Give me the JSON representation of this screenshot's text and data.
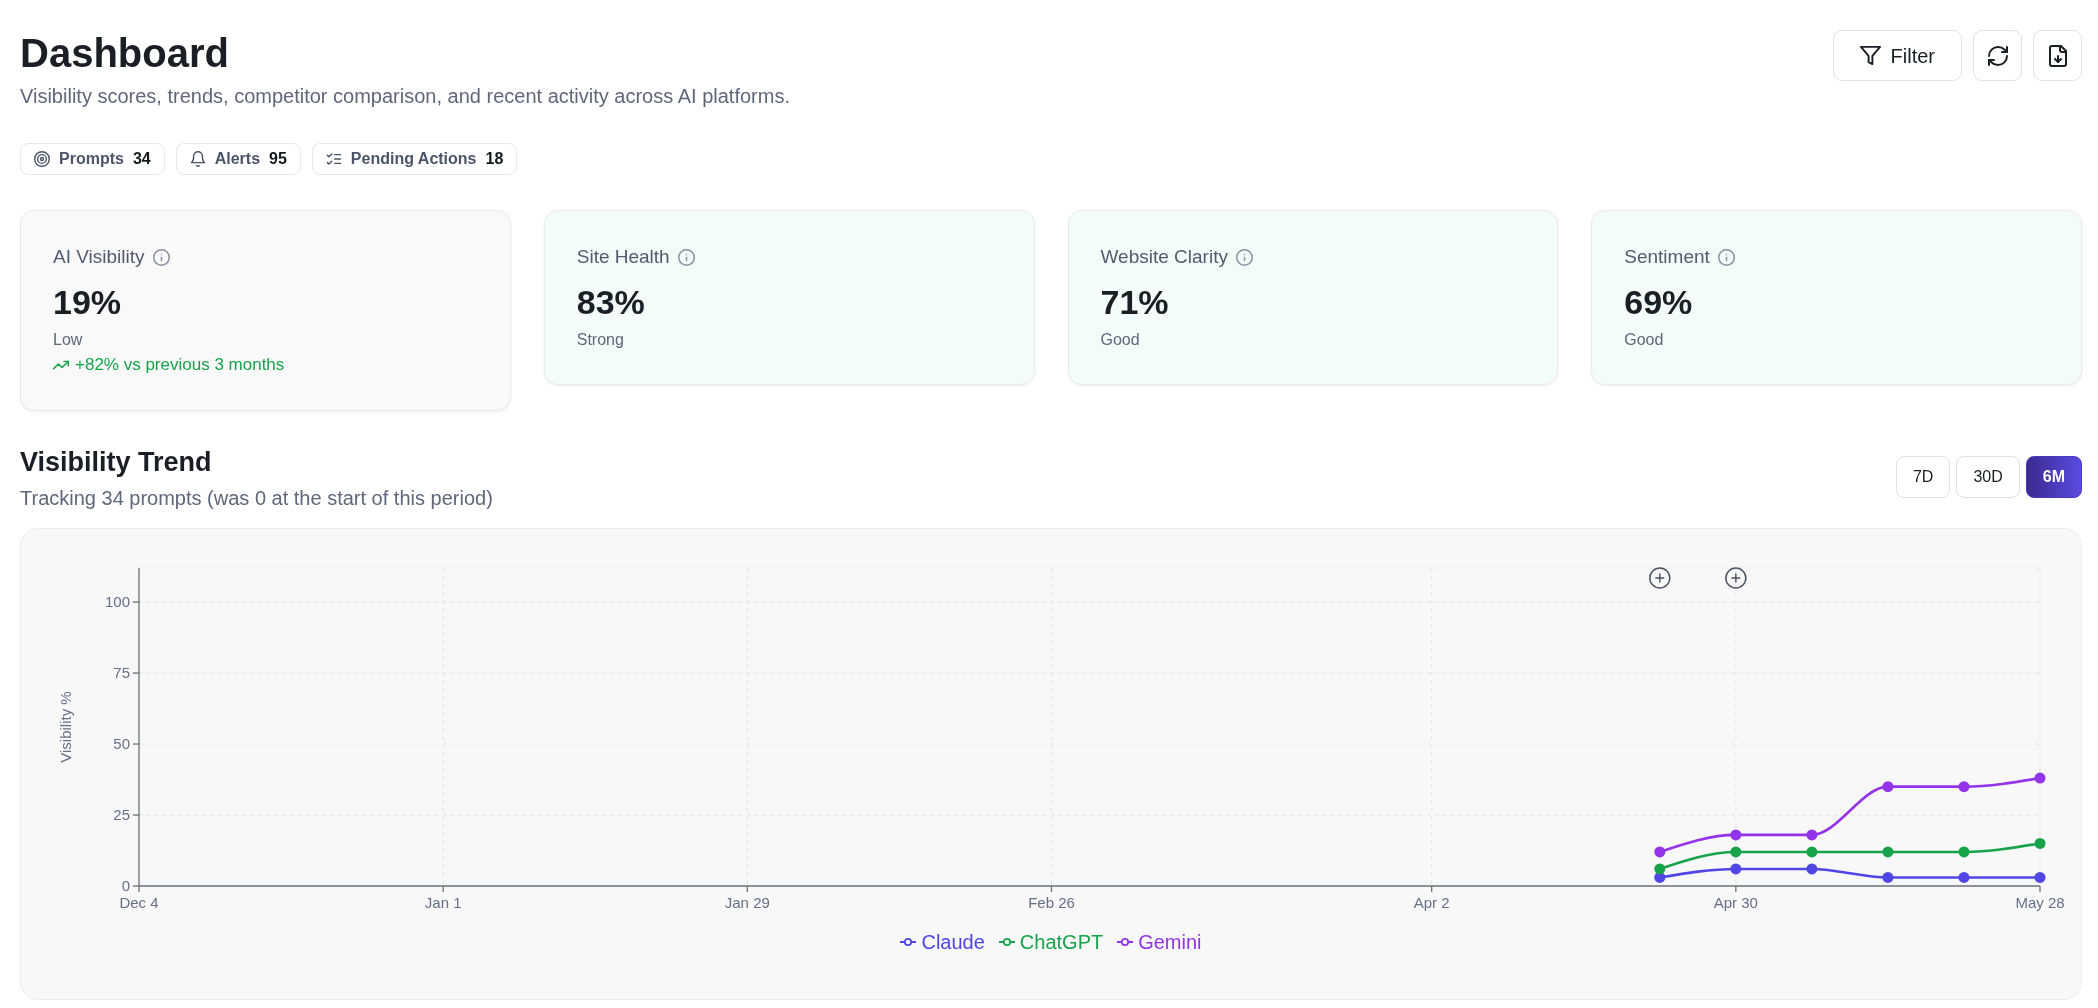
{
  "header": {
    "title": "Dashboard",
    "subtitle": "Visibility scores, trends, competitor comparison, and recent activity across AI platforms.",
    "actions": [
      {
        "kind": "filter",
        "label": "Filter"
      },
      {
        "kind": "refresh"
      },
      {
        "kind": "export"
      }
    ]
  },
  "stats": [
    {
      "kind": "prompts",
      "label": "Prompts",
      "count": "34"
    },
    {
      "kind": "alerts",
      "label": "Alerts",
      "count": "95"
    },
    {
      "kind": "actions",
      "label": "Pending Actions",
      "count": "18"
    }
  ],
  "metric_cards": [
    {
      "kind": "neutral",
      "title": "AI Visibility",
      "value": "19%",
      "rating": "Low",
      "trend": "+82% vs previous 3 months"
    },
    {
      "kind": "positive",
      "title": "Site Health",
      "value": "83%",
      "rating": "Strong"
    },
    {
      "kind": "positive",
      "title": "Website Clarity",
      "value": "71%",
      "rating": "Good"
    },
    {
      "kind": "positive",
      "title": "Sentiment",
      "value": "69%",
      "rating": "Good"
    }
  ],
  "visibility_trend": {
    "title": "Visibility Trend",
    "subtitle": "Tracking 34 prompts (was 0 at the start of this period)",
    "ranges": [
      {
        "label": "7D",
        "selected": false
      },
      {
        "label": "30D",
        "selected": false
      },
      {
        "label": "6M",
        "selected": true
      }
    ],
    "event_markers": [
      {
        "kind": "add"
      },
      {
        "kind": "add"
      }
    ],
    "chart_data": {
      "type": "line",
      "ylabel": "Visibility %",
      "grid": true,
      "legend": "bottom",
      "categories": [
        "Dec 4",
        null,
        null,
        null,
        "Jan 1",
        null,
        null,
        null,
        "Jan 29",
        null,
        null,
        null,
        "Feb 26",
        null,
        null,
        null,
        null,
        "Apr 2",
        null,
        null,
        null,
        "Apr 30",
        null,
        null,
        null,
        "May 28"
      ],
      "ylim": [
        0,
        112
      ],
      "yticks": [
        0,
        25,
        50,
        75,
        100
      ],
      "series": [
        {
          "name": "Claude",
          "color": "#4f46e5",
          "marker": "circle",
          "values": [
            null,
            null,
            null,
            null,
            null,
            null,
            null,
            null,
            null,
            null,
            null,
            null,
            null,
            null,
            null,
            null,
            null,
            null,
            null,
            null,
            3,
            6,
            6,
            3,
            3,
            3
          ]
        },
        {
          "name": "ChatGPT",
          "color": "#16a34a",
          "marker": "circle",
          "values": [
            null,
            null,
            null,
            null,
            null,
            null,
            null,
            null,
            null,
            null,
            null,
            null,
            null,
            null,
            null,
            null,
            null,
            null,
            null,
            null,
            6,
            12,
            12,
            12,
            12,
            15
          ]
        },
        {
          "name": "Gemini",
          "color": "#9333ea",
          "marker": "circle",
          "values": [
            null,
            null,
            null,
            null,
            null,
            null,
            null,
            null,
            null,
            null,
            null,
            null,
            null,
            null,
            null,
            null,
            null,
            null,
            null,
            null,
            12,
            18,
            18,
            35,
            35,
            38
          ]
        }
      ]
    }
  }
}
